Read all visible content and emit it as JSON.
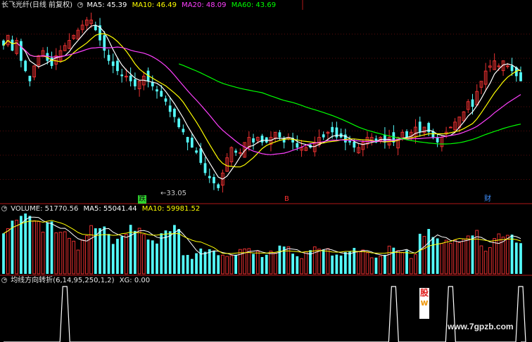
{
  "colors": {
    "bg": "#000000",
    "axis": "#b01818",
    "up": "#e83030",
    "down": "#54fcfc",
    "ma5": "#ffffff",
    "ma10": "#ffff00",
    "ma20": "#ff40ff",
    "ma60": "#00ff00",
    "xg": "#ffffff"
  },
  "price_header": {
    "stock": "长飞光纤(日线 前复权)",
    "ma5": "MA5: 45.39",
    "ma10": "MA10: 46.49",
    "ma20": "MA20: 48.09",
    "ma60": "MA60: 43.69"
  },
  "volume_header": {
    "volume": "VOLUME: 51770.56",
    "ma5": "MA5: 55041.44",
    "ma10": "MA10: 59981.52"
  },
  "indicator_header": {
    "name": "均线方向转折(6,14,95,250,1,2)",
    "xg": "XG: 0.00"
  },
  "annotations": {
    "low_label": "←33.05",
    "marker_die": "跌",
    "marker_b": "B",
    "marker_cai": "财"
  },
  "watermark": "www.7gpzb.com",
  "logo_text": [
    "股",
    "w"
  ],
  "chart_data": [
    {
      "type": "candlestick",
      "title": "长飞光纤(日线 前复权)",
      "series": [
        {
          "name": "MA5",
          "value": 45.39
        },
        {
          "name": "MA10",
          "value": 46.49
        },
        {
          "name": "MA20",
          "value": 48.09
        },
        {
          "name": "MA60",
          "value": 43.69
        }
      ],
      "annotations": [
        {
          "text": "←33.05",
          "value": 33.05
        }
      ],
      "close_approx": [
        61,
        63,
        60,
        62,
        58,
        56,
        54,
        57,
        59,
        60,
        58,
        57,
        59,
        60,
        61,
        62,
        63,
        64,
        65,
        66,
        66,
        64,
        62,
        60,
        58,
        57,
        56,
        55,
        55,
        54,
        53,
        54,
        55,
        54,
        53,
        52,
        51,
        50,
        48,
        47,
        45,
        44,
        42,
        41,
        40,
        38,
        36,
        35,
        34,
        33.05,
        36,
        39,
        41,
        40,
        40,
        42,
        43,
        42,
        43,
        42,
        42,
        43,
        44,
        43,
        42,
        43,
        42,
        41,
        41,
        41,
        41,
        42,
        43,
        43,
        44,
        44,
        43,
        43,
        42,
        42,
        41,
        41,
        42,
        43,
        43,
        42,
        43,
        42,
        43,
        42,
        43,
        44,
        43,
        44,
        45,
        44,
        45,
        44,
        43,
        42,
        43,
        44,
        45,
        46,
        47,
        48,
        50,
        49,
        52,
        54,
        56,
        57,
        58,
        57,
        58,
        57,
        56,
        55,
        54
      ]
    },
    {
      "type": "bar",
      "title": "VOLUME",
      "series": [
        {
          "name": "VOLUME",
          "value": 51770.56
        },
        {
          "name": "MA5",
          "value": 55041.44
        },
        {
          "name": "MA10",
          "value": 59981.52
        }
      ]
    },
    {
      "type": "line",
      "title": "均线方向转折(6,14,95,250,1,2)",
      "series": [
        {
          "name": "XG",
          "value": 0.0
        }
      ],
      "signals_approx_index": [
        14,
        89,
        102,
        118
      ]
    }
  ]
}
